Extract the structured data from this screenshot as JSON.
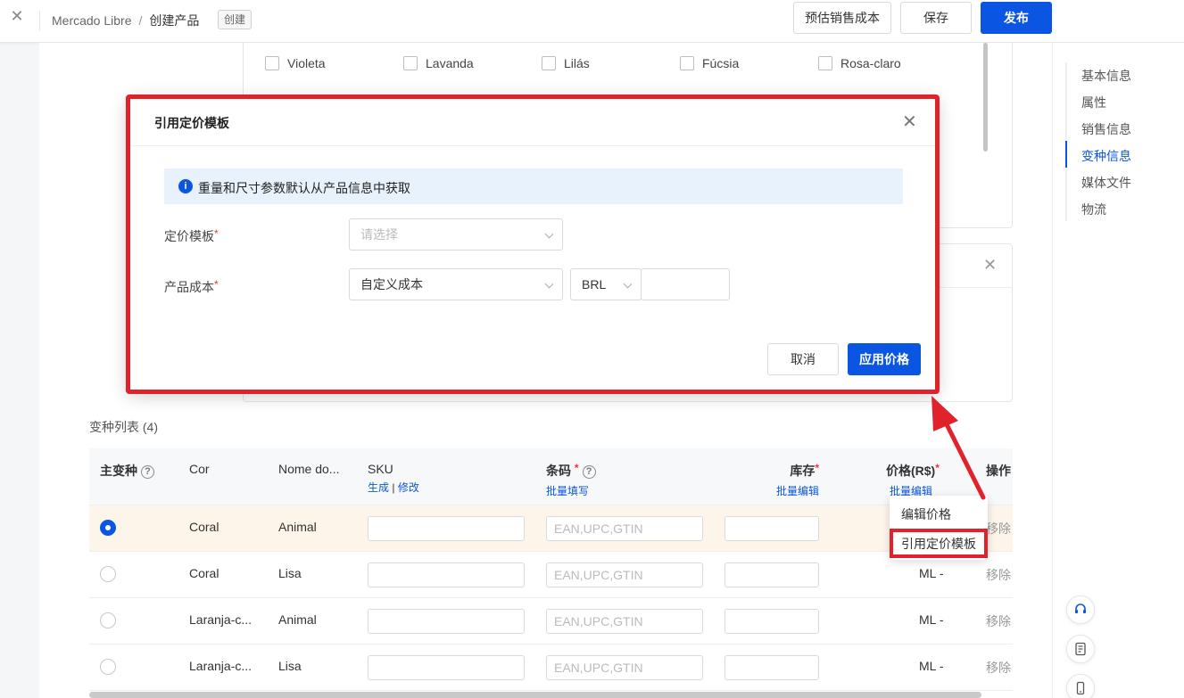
{
  "header": {
    "breadcrumb_root": "Mercado Libre",
    "breadcrumb_current": "创建产品",
    "status_tag": "创建",
    "estimate_cost_label": "预估销售成本",
    "save_label": "保存",
    "publish_label": "发布"
  },
  "colors_row": [
    "Violeta",
    "Lavanda",
    "Lilás",
    "Fúcsia",
    "Rosa-claro"
  ],
  "nav": {
    "items": [
      "基本信息",
      "属性",
      "销售信息",
      "变种信息",
      "媒体文件",
      "物流"
    ],
    "active_index": 3
  },
  "variants": {
    "title": "变种列表 (4)",
    "columns": {
      "main": "主变种",
      "cor": "Cor",
      "nome": "Nome do...",
      "sku": "SKU",
      "sku_generate": "生成",
      "sku_sep": "|",
      "sku_edit": "修改",
      "barcode": "条码",
      "barcode_batch": "批量填写",
      "stock": "库存",
      "stock_batch": "批量编辑",
      "price": "价格(R$)",
      "price_batch": "批量编辑",
      "actions": "操作"
    },
    "barcode_placeholder": "EAN,UPC,GTIN",
    "remove_label": "移除",
    "rows": [
      {
        "cor": "Coral",
        "nome": "Animal",
        "price": "",
        "selected": true
      },
      {
        "cor": "Coral",
        "nome": "Lisa",
        "price": "ML -",
        "selected": false
      },
      {
        "cor": "Laranja-c...",
        "nome": "Animal",
        "price": "ML -",
        "selected": false
      },
      {
        "cor": "Laranja-c...",
        "nome": "Lisa",
        "price": "ML -",
        "selected": false
      }
    ]
  },
  "price_menu": {
    "edit_price": "编辑价格",
    "apply_template": "引用定价模板"
  },
  "modal": {
    "title": "引用定价模板",
    "info": "重量和尺寸参数默认从产品信息中获取",
    "template_label": "定价模板",
    "template_placeholder": "请选择",
    "cost_label": "产品成本",
    "cost_type": "自定义成本",
    "currency": "BRL",
    "cost_value": "",
    "cancel_label": "取消",
    "apply_label": "应用价格"
  },
  "accent_color": "#0a56e3",
  "highlight_color": "#e2222b"
}
